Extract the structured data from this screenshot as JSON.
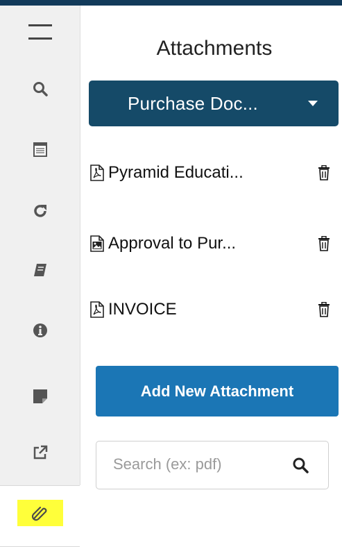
{
  "panel": {
    "title": "Attachments"
  },
  "document_select": {
    "selected": "Purchase Doc..."
  },
  "attachments": [
    {
      "name": "Pyramid Educati...",
      "type": "pdf"
    },
    {
      "name": "Approval to Pur...",
      "type": "image"
    },
    {
      "name": "INVOICE",
      "type": "pdf"
    }
  ],
  "add_button": {
    "label": "Add New Attachment"
  },
  "search": {
    "placeholder": "Search (ex: pdf)",
    "value": ""
  },
  "sidebar": {
    "items": [
      {
        "icon": "menu-icon"
      },
      {
        "icon": "search-icon"
      },
      {
        "icon": "calendar-icon"
      },
      {
        "icon": "refresh-icon"
      },
      {
        "icon": "book-icon"
      },
      {
        "icon": "info-icon"
      },
      {
        "icon": "note-icon"
      },
      {
        "icon": "external-link-icon"
      },
      {
        "icon": "paperclip-icon",
        "active": true
      }
    ]
  },
  "colors": {
    "top_bar": "#123a5a",
    "select_bg": "#154a68",
    "add_button_bg": "#1b76b5",
    "active_highlight": "#ffff3a",
    "sidebar_bg": "#f0f0f0"
  }
}
